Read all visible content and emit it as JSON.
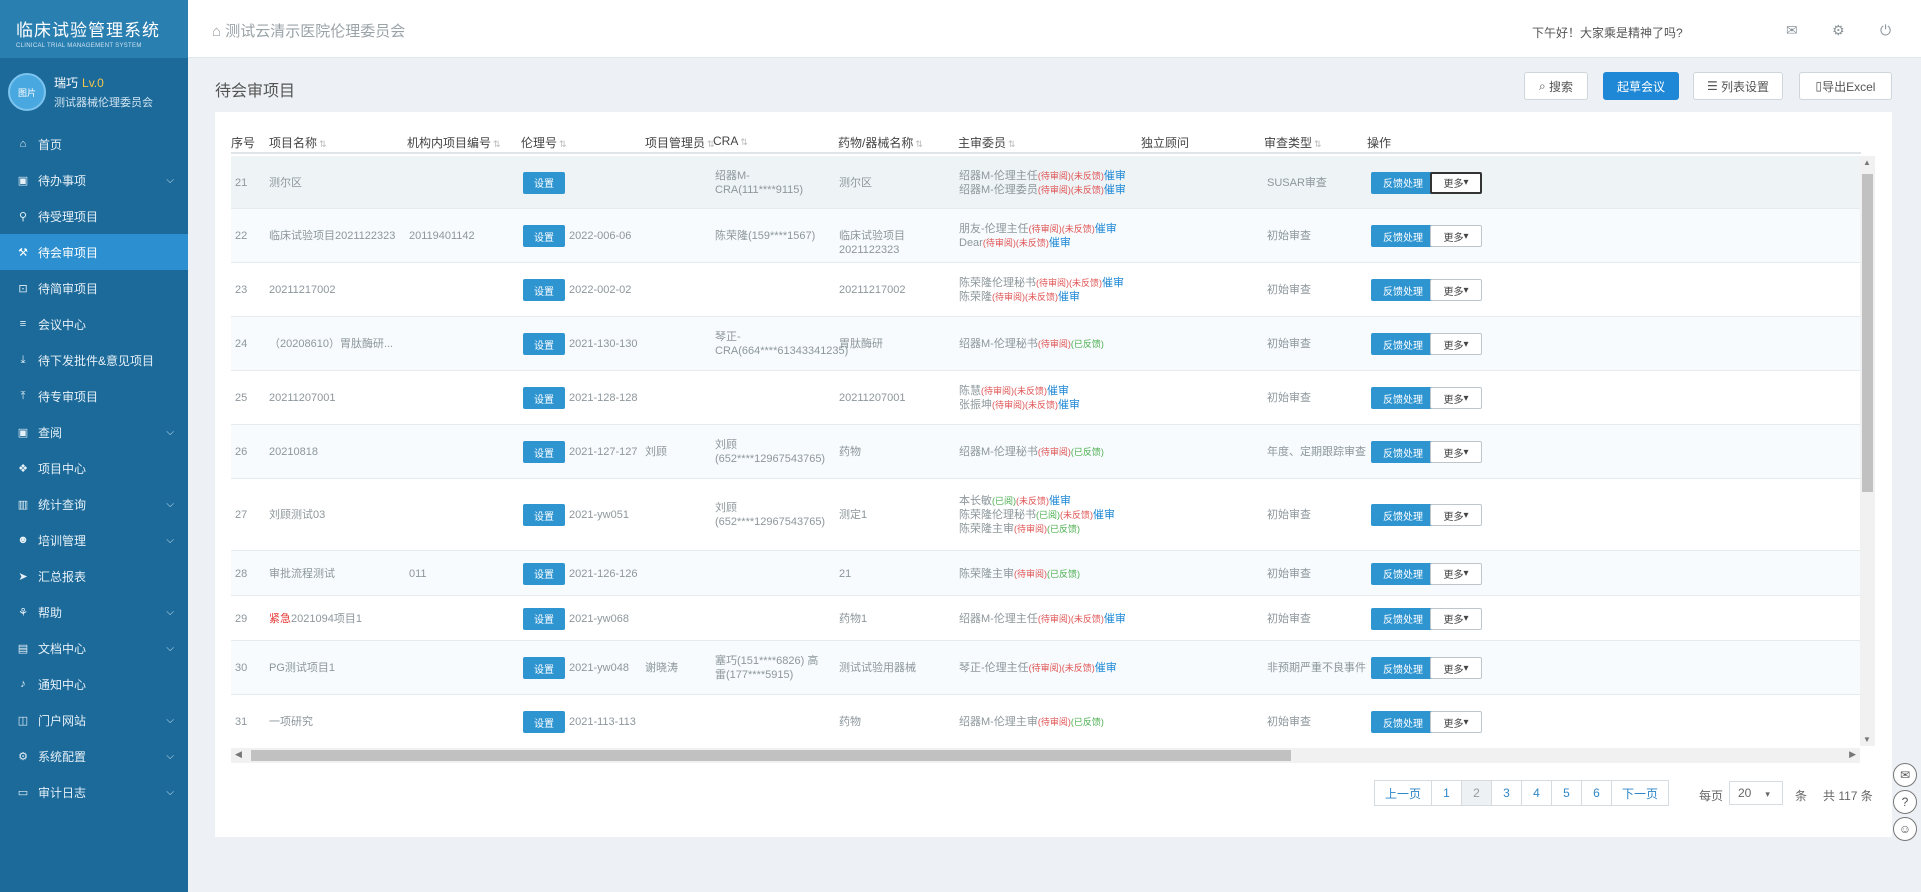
{
  "brand": {
    "title": "临床试验管理系统",
    "subtitle": "CLINICAL TRIAL MANAGEMENT SYSTEM"
  },
  "user": {
    "avatar_text": "图片",
    "name": "瑞巧",
    "level": "Lv.0",
    "org": "测试器械伦理委员会..."
  },
  "menu": [
    {
      "label": "首页",
      "icon": "home-icon",
      "glyph": "⌂",
      "chevron": false,
      "active": false
    },
    {
      "label": "待办事项",
      "icon": "calendar-icon",
      "glyph": "▣",
      "chevron": true,
      "active": false
    },
    {
      "label": "待受理项目",
      "icon": "link-icon",
      "glyph": "⚲",
      "chevron": false,
      "active": false
    },
    {
      "label": "待会审项目",
      "icon": "gavel-icon",
      "glyph": "⚒",
      "chevron": false,
      "active": true
    },
    {
      "label": "待简审项目",
      "icon": "crop-icon",
      "glyph": "⊡",
      "chevron": false,
      "active": false
    },
    {
      "label": "会议中心",
      "icon": "list-icon",
      "glyph": "≡",
      "chevron": false,
      "active": false
    },
    {
      "label": "待下发批件&意见项目",
      "icon": "download-icon",
      "glyph": "⤓",
      "chevron": false,
      "active": false
    },
    {
      "label": "待专审项目",
      "icon": "upload-icon",
      "glyph": "⤒",
      "chevron": false,
      "active": false
    },
    {
      "label": "查阅",
      "icon": "calendar-icon",
      "glyph": "▣",
      "chevron": true,
      "active": false
    },
    {
      "label": "项目中心",
      "icon": "cubes-icon",
      "glyph": "❖",
      "chevron": false,
      "active": false
    },
    {
      "label": "统计查询",
      "icon": "bar-chart-icon",
      "glyph": "▥",
      "chevron": true,
      "active": false
    },
    {
      "label": "培训管理",
      "icon": "users-icon",
      "glyph": "☻",
      "chevron": true,
      "active": false
    },
    {
      "label": "汇总报表",
      "icon": "send-icon",
      "glyph": "➤",
      "chevron": false,
      "active": false
    },
    {
      "label": "帮助",
      "icon": "sitemap-icon",
      "glyph": "⚘",
      "chevron": true,
      "active": false
    },
    {
      "label": "文档中心",
      "icon": "file-icon",
      "glyph": "▤",
      "chevron": true,
      "active": false
    },
    {
      "label": "通知中心",
      "icon": "bell-icon",
      "glyph": "♪",
      "chevron": false,
      "active": false
    },
    {
      "label": "门户网站",
      "icon": "window-icon",
      "glyph": "◫",
      "chevron": true,
      "active": false
    },
    {
      "label": "系统配置",
      "icon": "cogs-icon",
      "glyph": "⚙",
      "chevron": true,
      "active": false
    },
    {
      "label": "审计日志",
      "icon": "book-icon",
      "glyph": "▭",
      "chevron": true,
      "active": false
    }
  ],
  "header": {
    "org_title": "测试云清示医院伦理委员会",
    "greeting": "下午好！大家乘是精神了吗?",
    "home_glyph": "⌂",
    "mail_glyph": "✉",
    "gear_glyph": "⚙",
    "power_glyph": "⏻"
  },
  "page": {
    "title": "待会审项目",
    "search_btn": "搜索",
    "meeting_btn": "起草会议",
    "columns_btn": "列表设置",
    "export_btn": "导出Excel"
  },
  "table": {
    "headers": [
      "序号",
      "项目名称",
      "机构内项目编号",
      "伦理号",
      "项目管理员",
      "CRA",
      "药物/器械名称",
      "主审委员",
      "独立顾问",
      "审查类型",
      "操作"
    ],
    "set_label": "设置",
    "feedback_label": "反馈处理",
    "more_label": "更多",
    "rows": [
      {
        "no": "21",
        "name": "测尔区",
        "inst_no": "",
        "ethics": "",
        "admin": "",
        "cra": "绍器M-CRA(111****9115)",
        "drug": "测尔区",
        "reviewers": [
          {
            "name": "绍器M-伦理主任",
            "tags": [
              "待审阅",
              "未反馈"
            ],
            "remind": "催审"
          },
          {
            "name": "绍器M-伦理委员",
            "tags": [
              "待审阅",
              "未反馈"
            ],
            "remind": "催审"
          }
        ],
        "review_type": "SUSAR审查"
      },
      {
        "no": "22",
        "name": "临床试验项目2021122323",
        "inst_no": "20119401142",
        "ethics": "2022-006-06",
        "admin": "",
        "cra": "陈荣隆(159****1567)",
        "drug": "临床试验项目2021122323",
        "reviewers": [
          {
            "name": "朋友-伦理主任",
            "tags": [
              "待审阅",
              "未反馈"
            ],
            "remind": "催审"
          },
          {
            "name": "Dear",
            "tags": [
              "待审阅",
              "未反馈"
            ],
            "remind": "催审"
          }
        ],
        "review_type": "初始审查"
      },
      {
        "no": "23",
        "name": "20211217002",
        "inst_no": "",
        "ethics": "2022-002-02",
        "admin": "",
        "cra": "",
        "drug": "20211217002",
        "reviewers": [
          {
            "name": "陈荣隆伦理秘书",
            "tags": [
              "待审阅",
              "未反馈"
            ],
            "remind": "催审"
          },
          {
            "name": "陈荣隆",
            "tags": [
              "待审阅",
              "未反馈"
            ],
            "remind": "催审"
          }
        ],
        "review_type": "初始审查"
      },
      {
        "no": "24",
        "name": "（20208610）胃肽酶研...",
        "inst_no": "",
        "ethics": "2021-130-130",
        "admin": "",
        "cra": "琴正-CRA(664****61343341235)",
        "drug": "胃肽酶研",
        "reviewers": [
          {
            "name": "绍器M-伦理秘书",
            "tags": [
              "待审阅",
              "已反馈"
            ],
            "remind": ""
          }
        ],
        "review_type": "初始审查"
      },
      {
        "no": "25",
        "name": "20211207001",
        "inst_no": "",
        "ethics": "2021-128-128",
        "admin": "",
        "cra": "",
        "drug": "20211207001",
        "reviewers": [
          {
            "name": "陈慧",
            "tags": [
              "待审阅",
              "未反馈"
            ],
            "remind": "催审"
          },
          {
            "name": "张振坤",
            "tags": [
              "待审阅",
              "未反馈"
            ],
            "remind": "催审"
          }
        ],
        "review_type": "初始审查"
      },
      {
        "no": "26",
        "name": "20210818",
        "inst_no": "",
        "ethics": "2021-127-127",
        "admin": "刘顾",
        "cra": "刘顾(652****12967543765)",
        "drug": "药物",
        "reviewers": [
          {
            "name": "绍器M-伦理秘书",
            "tags": [
              "待审阅",
              "已反馈"
            ],
            "remind": ""
          }
        ],
        "review_type": "年度、定期跟踪审查"
      },
      {
        "no": "27",
        "name": "刘顾测试03",
        "inst_no": "",
        "ethics": "2021-yw051",
        "admin": "",
        "cra": "刘顾(652****12967543765)",
        "drug": "测定1",
        "reviewers": [
          {
            "name": "本长敏",
            "tags": [
              "已阅",
              "未反馈"
            ],
            "remind": "催审"
          },
          {
            "name": "陈荣隆伦理秘书",
            "tags": [
              "已阅",
              "未反馈"
            ],
            "remind": "催审"
          },
          {
            "name": "陈荣隆主审",
            "tags": [
              "待审阅",
              "已反馈"
            ],
            "remind": ""
          }
        ],
        "review_type": "初始审查"
      },
      {
        "no": "28",
        "name": "审批流程测试",
        "inst_no": "011",
        "ethics": "2021-126-126",
        "admin": "",
        "cra": "",
        "drug": "21",
        "reviewers": [
          {
            "name": "陈荣隆主审",
            "tags": [
              "待审阅",
              "已反馈"
            ],
            "remind": ""
          }
        ],
        "review_type": "初始审查"
      },
      {
        "no": "29",
        "name_prefix": "紧急",
        "name": "2021094项目1",
        "inst_no": "",
        "ethics": "2021-yw068",
        "admin": "",
        "cra": "",
        "drug": "药物1",
        "reviewers": [
          {
            "name": "绍器M-伦理主任",
            "tags": [
              "待审阅",
              "未反馈"
            ],
            "remind": "催审"
          }
        ],
        "review_type": "初始审查"
      },
      {
        "no": "30",
        "name": "PG测试项目1",
        "inst_no": "",
        "ethics": "2021-yw048",
        "admin": "谢晓涛",
        "cra": "塞巧(151****6826)  高雷(177****5915)",
        "drug": "测试试验用器械",
        "reviewers": [
          {
            "name": "琴正-伦理主任",
            "tags": [
              "待审阅",
              "未反馈"
            ],
            "remind": "催审"
          }
        ],
        "review_type": "非预期严重不良事件审查"
      },
      {
        "no": "31",
        "name": "一项研究",
        "inst_no": "",
        "ethics": "2021-113-113",
        "admin": "",
        "cra": "",
        "drug": "药物",
        "reviewers": [
          {
            "name": "绍器M-伦理主审",
            "tags": [
              "待审阅",
              "已反馈"
            ],
            "remind": ""
          }
        ],
        "review_type": "初始审查"
      }
    ]
  },
  "pagination": {
    "prev": "上一页",
    "pages": [
      "1",
      "2",
      "3",
      "4",
      "5",
      "6"
    ],
    "current": "2",
    "next": "下一页",
    "per_page_label": "每页",
    "per_page_value": "20",
    "unit": "条",
    "total_text": "共 117 条"
  },
  "colors": {
    "sidebar": "#1b6a9a",
    "brand": "#2a7fb1",
    "active": "#2b8fd0",
    "primary": "#1e88d6"
  }
}
